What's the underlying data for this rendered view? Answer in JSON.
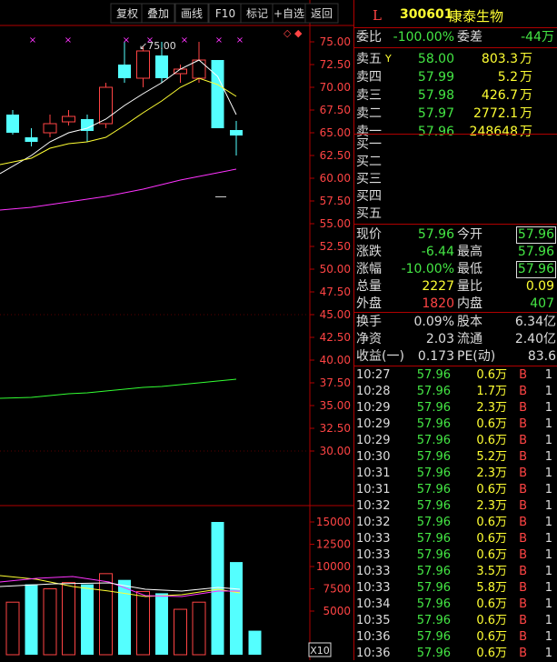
{
  "toolbar": [
    {
      "label": "复权",
      "name": "restore-rights-button"
    },
    {
      "label": "叠加",
      "name": "overlay-button"
    },
    {
      "label": "画线",
      "name": "draw-line-button"
    },
    {
      "label": "F10",
      "name": "f10-button"
    },
    {
      "label": "标记",
      "name": "mark-button"
    },
    {
      "label": "+自选",
      "name": "add-watchlist-button"
    },
    {
      "label": "返回",
      "name": "back-button"
    }
  ],
  "stock": {
    "flag": "L",
    "code": "300601",
    "name": "康泰生物"
  },
  "commission": {
    "ratio_label": "委比",
    "ratio": "-100.00%",
    "diff_label": "委差",
    "diff": "-44万"
  },
  "asks": [
    {
      "label": "卖五",
      "mark": "Y",
      "price": "58.00",
      "vol": "803.3万"
    },
    {
      "label": "卖四",
      "mark": "",
      "price": "57.99",
      "vol": "5.2万"
    },
    {
      "label": "卖三",
      "mark": "",
      "price": "57.98",
      "vol": "426.7万"
    },
    {
      "label": "卖二",
      "mark": "",
      "price": "57.97",
      "vol": "2772.1万"
    },
    {
      "label": "卖一",
      "mark": "",
      "price": "57.96",
      "vol": "248648万"
    }
  ],
  "bids": [
    {
      "label": "买一"
    },
    {
      "label": "买二"
    },
    {
      "label": "买三"
    },
    {
      "label": "买四"
    },
    {
      "label": "买五"
    }
  ],
  "quote": [
    {
      "l1": "现价",
      "v1": "57.96",
      "c1": "g",
      "l2": "今开",
      "v2": "57.96",
      "c2": "g",
      "box": true
    },
    {
      "l1": "涨跌",
      "v1": "-6.44",
      "c1": "g",
      "l2": "最高",
      "v2": "57.96",
      "c2": "g",
      "box": false
    },
    {
      "l1": "涨幅",
      "v1": "-10.00%",
      "c1": "g",
      "l2": "最低",
      "v2": "57.96",
      "c2": "g",
      "box": true
    },
    {
      "l1": "总量",
      "v1": "2227",
      "c1": "y",
      "l2": "量比",
      "v2": "0.09",
      "c2": "y",
      "box": false
    },
    {
      "l1": "外盘",
      "v1": "1820",
      "c1": "r",
      "l2": "内盘",
      "v2": "407",
      "c2": "g",
      "box": false
    }
  ],
  "fundamentals": [
    {
      "l1": "换手",
      "v1": "0.09%",
      "l2": "股本",
      "v2": "6.34亿"
    },
    {
      "l1": "净资",
      "v1": "2.03",
      "l2": "流通",
      "v2": "2.40亿"
    },
    {
      "l1": "收益(一)",
      "v1": "0.173",
      "l2": "PE(动)",
      "v2": "83.6"
    }
  ],
  "ticks": [
    {
      "time": "10:27",
      "price": "57.96",
      "vol": "0.6万",
      "side": "B",
      "n": "1"
    },
    {
      "time": "10:28",
      "price": "57.96",
      "vol": "1.7万",
      "side": "B",
      "n": "1"
    },
    {
      "time": "10:29",
      "price": "57.96",
      "vol": "2.3万",
      "side": "B",
      "n": "1"
    },
    {
      "time": "10:29",
      "price": "57.96",
      "vol": "0.6万",
      "side": "B",
      "n": "1"
    },
    {
      "time": "10:29",
      "price": "57.96",
      "vol": "0.6万",
      "side": "B",
      "n": "1"
    },
    {
      "time": "10:30",
      "price": "57.96",
      "vol": "5.2万",
      "side": "B",
      "n": "1"
    },
    {
      "time": "10:31",
      "price": "57.96",
      "vol": "2.3万",
      "side": "B",
      "n": "1"
    },
    {
      "time": "10:31",
      "price": "57.96",
      "vol": "0.6万",
      "side": "B",
      "n": "1"
    },
    {
      "time": "10:32",
      "price": "57.96",
      "vol": "2.3万",
      "side": "B",
      "n": "1"
    },
    {
      "time": "10:32",
      "price": "57.96",
      "vol": "0.6万",
      "side": "B",
      "n": "1"
    },
    {
      "time": "10:33",
      "price": "57.96",
      "vol": "0.6万",
      "side": "B",
      "n": "1"
    },
    {
      "time": "10:33",
      "price": "57.96",
      "vol": "0.6万",
      "side": "B",
      "n": "1"
    },
    {
      "time": "10:33",
      "price": "57.96",
      "vol": "3.5万",
      "side": "B",
      "n": "1"
    },
    {
      "time": "10:33",
      "price": "57.96",
      "vol": "5.8万",
      "side": "B",
      "n": "1"
    },
    {
      "time": "10:34",
      "price": "57.96",
      "vol": "0.6万",
      "side": "B",
      "n": "1"
    },
    {
      "time": "10:35",
      "price": "57.96",
      "vol": "0.6万",
      "side": "B",
      "n": "1"
    },
    {
      "time": "10:36",
      "price": "57.96",
      "vol": "0.6万",
      "side": "B",
      "n": "1"
    },
    {
      "time": "10:36",
      "price": "57.96",
      "vol": "0.6万",
      "side": "B",
      "n": "1"
    }
  ],
  "chart_data": {
    "type": "candlestick",
    "price_ticks": [
      "75.00",
      "72.50",
      "70.00",
      "67.50",
      "65.00",
      "62.50",
      "60.00",
      "57.50",
      "55.00",
      "52.50",
      "50.00",
      "47.50",
      "45.00",
      "42.50",
      "40.00",
      "37.50",
      "35.00",
      "32.50",
      "30.00"
    ],
    "price_range": [
      27.5,
      77.5
    ],
    "high_annotation": "75.00",
    "candles": [
      {
        "o": 67.0,
        "c": 65.0,
        "h": 67.5,
        "l": 64.8
      },
      {
        "o": 64.5,
        "c": 64.0,
        "h": 65.5,
        "l": 63.5
      },
      {
        "o": 65.0,
        "c": 66.0,
        "h": 67.0,
        "l": 64.5
      },
      {
        "o": 66.2,
        "c": 66.8,
        "h": 67.5,
        "l": 65.8
      },
      {
        "o": 66.5,
        "c": 65.2,
        "h": 67.0,
        "l": 64.0
      },
      {
        "o": 66.0,
        "c": 70.0,
        "h": 70.5,
        "l": 65.5
      },
      {
        "o": 72.5,
        "c": 71.0,
        "h": 75.0,
        "l": 70.5
      },
      {
        "o": 71.0,
        "c": 74.0,
        "h": 74.5,
        "l": 70.0
      },
      {
        "o": 73.5,
        "c": 71.0,
        "h": 75.0,
        "l": 70.5
      },
      {
        "o": 71.5,
        "c": 72.0,
        "h": 72.5,
        "l": 70.5
      },
      {
        "o": 71.0,
        "c": 73.0,
        "h": 75.0,
        "l": 70.5
      },
      {
        "o": 73.0,
        "c": 65.5,
        "h": 73.0,
        "l": 65.5
      },
      {
        "o": 65.3,
        "c": 64.7,
        "h": 66.3,
        "l": 62.5
      },
      {
        "o": 57.96,
        "c": 57.96,
        "h": 57.96,
        "l": 57.96
      }
    ],
    "ma_yellow": [
      61.5,
      62.2,
      63.3,
      63.8,
      64.0,
      64.5,
      65.8,
      67.2,
      68.5,
      70.0,
      71.0,
      70.3,
      69.0
    ],
    "ma_white": [
      60.5,
      62.5,
      64.0,
      65.0,
      65.5,
      66.5,
      68.0,
      69.3,
      70.5,
      72.0,
      73.0,
      71.2,
      67.0
    ],
    "ma_magenta": [
      56.5,
      56.8,
      57.1,
      57.4,
      57.7,
      58.0,
      58.4,
      58.8,
      59.3,
      59.8,
      60.2,
      60.6,
      61.0
    ],
    "ma_green": [
      35.8,
      35.9,
      36.1,
      36.3,
      36.4,
      36.6,
      36.8,
      37.0,
      37.1,
      37.3,
      37.5,
      37.7,
      37.9
    ],
    "volume_ticks": [
      "15000",
      "12500",
      "10000",
      "7500",
      "5000"
    ],
    "volume_range": [
      2500,
      16500
    ],
    "volumes": [
      6000,
      8000,
      7500,
      8200,
      8000,
      9200,
      8500,
      7200,
      7000,
      5200,
      6000,
      15000,
      10500,
      2800
    ],
    "volume_multiplier": "X10"
  }
}
